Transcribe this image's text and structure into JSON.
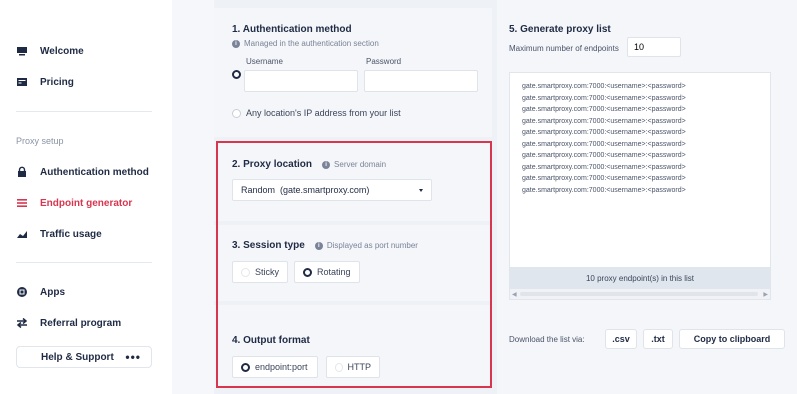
{
  "sidebar": {
    "items_top": [
      {
        "label": "Welcome",
        "icon": "monitor-icon"
      },
      {
        "label": "Pricing",
        "icon": "card-icon"
      }
    ],
    "section_label": "Proxy setup",
    "items_proxy": [
      {
        "label": "Authentication method",
        "icon": "lock-icon"
      },
      {
        "label": "Endpoint generator",
        "icon": "list-icon",
        "active": true
      },
      {
        "label": "Traffic usage",
        "icon": "chart-icon"
      }
    ],
    "items_bottom": [
      {
        "label": "Apps",
        "icon": "apps-icon"
      },
      {
        "label": "Referral program",
        "icon": "transfer-icon"
      }
    ],
    "help": {
      "label": "Help & Support",
      "dots": "•••"
    }
  },
  "auth": {
    "title": "1. Authentication method",
    "hint": "Managed in the authentication section",
    "username_label": "Username",
    "password_label": "Password",
    "username_value": "",
    "password_value": "",
    "alt_option": "Any location's IP address from your list"
  },
  "location": {
    "title": "2. Proxy location",
    "hint": "Server domain",
    "selected": "Random  (gate.smartproxy.com)"
  },
  "session": {
    "title": "3. Session type",
    "hint": "Displayed as port number",
    "options": [
      "Sticky",
      "Rotating"
    ],
    "selected": "Rotating"
  },
  "output": {
    "title": "4. Output format",
    "options": [
      "endpoint:port",
      "HTTP"
    ],
    "selected": "endpoint:port"
  },
  "generate": {
    "title": "5. Generate proxy list",
    "max_label": "Maximum number of endpoints",
    "max_value": "10",
    "lines": [
      "gate.smartproxy.com:7000:<username>:<password>",
      "gate.smartproxy.com:7000:<username>:<password>",
      "gate.smartproxy.com:7000:<username>:<password>",
      "gate.smartproxy.com:7000:<username>:<password>",
      "gate.smartproxy.com:7000:<username>:<password>",
      "gate.smartproxy.com:7000:<username>:<password>",
      "gate.smartproxy.com:7000:<username>:<password>",
      "gate.smartproxy.com:7000:<username>:<password>",
      "gate.smartproxy.com:7000:<username>:<password>",
      "gate.smartproxy.com:7000:<username>:<password>"
    ],
    "count_text": "10 proxy endpoint(s) in this list",
    "download_label": "Download the list via:",
    "csv_label": ".csv",
    "txt_label": ".txt",
    "copy_label": "Copy to clipboard"
  },
  "colors": {
    "accent": "#d8364f",
    "text": "#1f2a44",
    "panel": "#f4f6f9"
  }
}
